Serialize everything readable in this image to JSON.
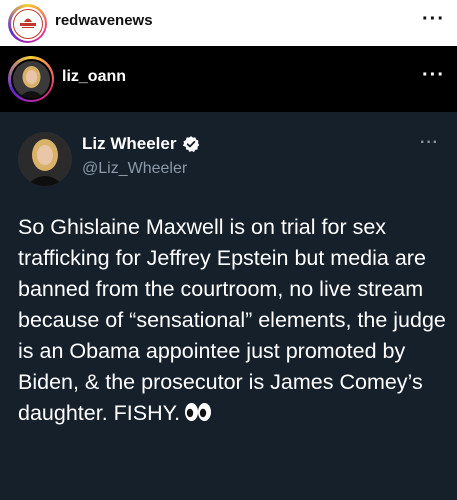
{
  "post": {
    "username": "redwavenews",
    "avatar_icon": "red-wave-news-logo",
    "more_icon": "more-horizontal-icon",
    "more_label": "···"
  },
  "repost": {
    "username": "liz_oann",
    "more_label": "···"
  },
  "tweet": {
    "display_name": "Liz Wheeler",
    "handle": "@Liz_Wheeler",
    "verified_icon": "verified-badge-icon",
    "more_label": "···",
    "text": "So Ghislaine Maxwell is on trial for sex trafficking for Jeffrey Epstein but media are banned from the courtroom, no live stream because of “sensational” elements, the judge is an Obama appointee just promoted by Biden, & the prosecutor is James Comey’s daughter. FISHY.",
    "emoji_icon": "eyes-emoji-icon"
  },
  "colors": {
    "tweet_bg": "#15202b",
    "handle_gray": "#8b98a5",
    "verified_blue": "#1d9bf0"
  }
}
